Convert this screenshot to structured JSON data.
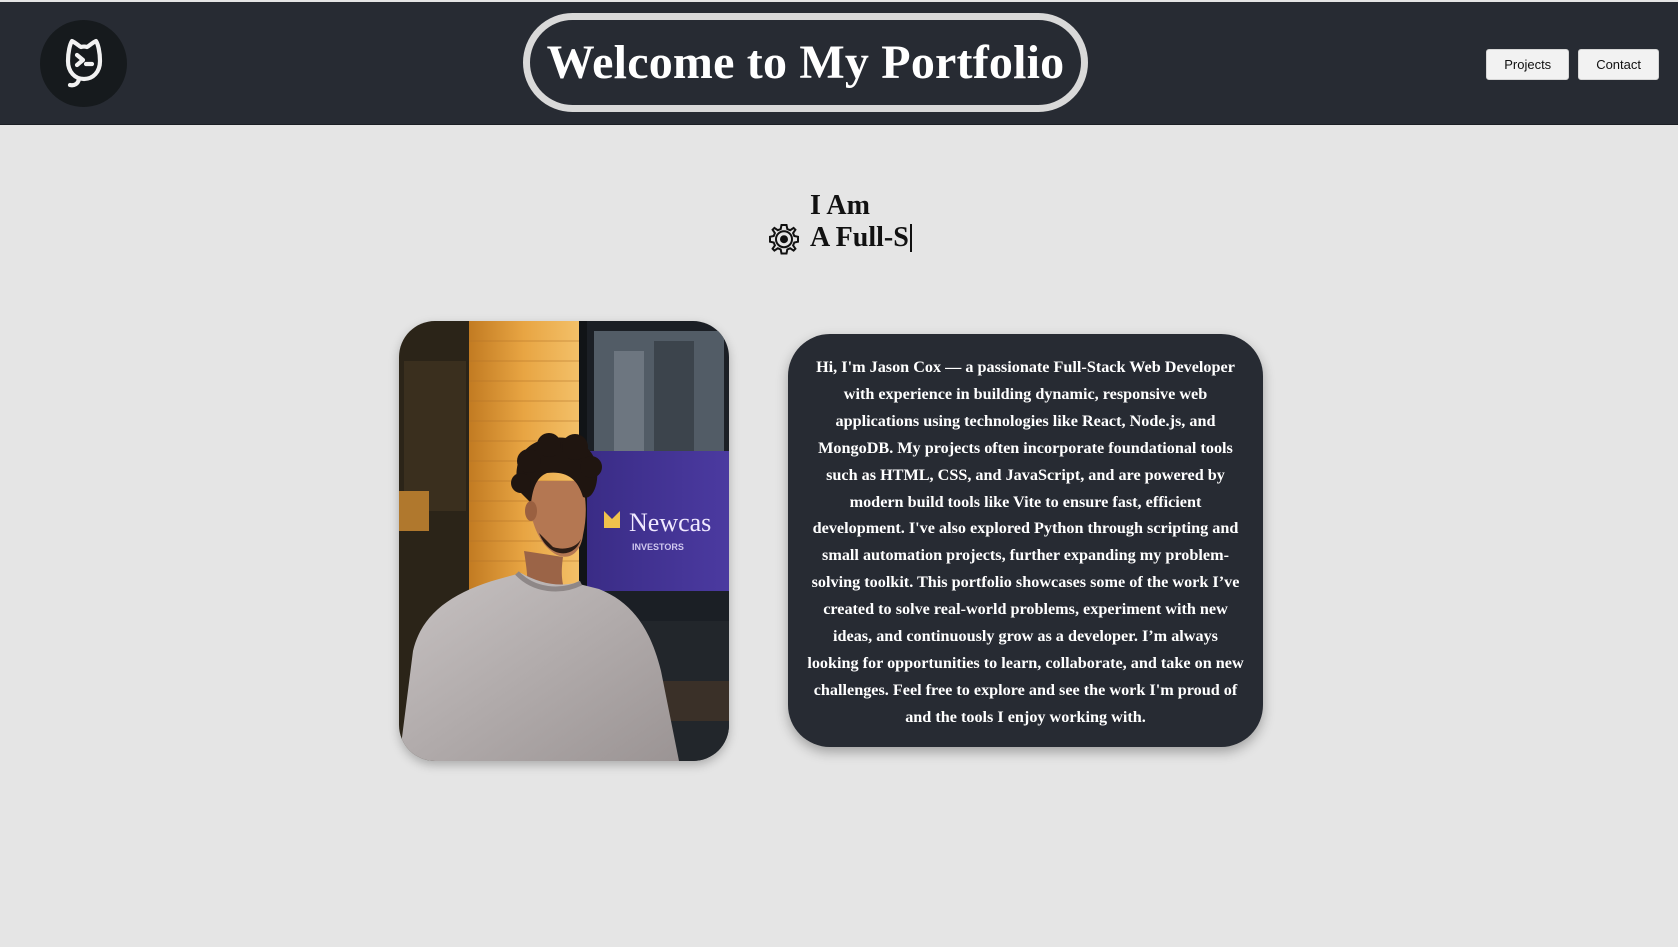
{
  "header": {
    "logo_icon": "github-cat-terminal-icon",
    "title": "Welcome to My Portfolio",
    "nav": [
      {
        "label": "Projects"
      },
      {
        "label": "Contact"
      }
    ]
  },
  "hero": {
    "icon": "gear-icon",
    "line1": "I Am",
    "line2": "A Full-S"
  },
  "profile": {
    "photo_alt_text": "Newcas",
    "photo_alt_sub": "INVESTORS"
  },
  "bio": {
    "text": "Hi, I'm Jason Cox — a passionate Full-Stack Web Developer with experience in building dynamic, responsive web applications using technologies like React, Node.js, and MongoDB. My projects often incorporate foundational tools such as HTML, CSS, and JavaScript, and are powered by modern build tools like Vite to ensure fast, efficient development. I've also explored Python through scripting and small automation projects, further expanding my problem-solving toolkit. This portfolio showcases some of the work I’ve created to solve real-world problems, experiment with new ideas, and continuously grow as a developer. I’m always looking for opportunities to learn, collaborate, and take on new challenges. Feel free to explore and see the work I'm proud of and the tools I enjoy working with."
  },
  "colors": {
    "header_bg": "#272b33",
    "page_bg": "#e5e5e5",
    "card_bg": "#272b33",
    "pill_border": "#d9d9d9"
  }
}
